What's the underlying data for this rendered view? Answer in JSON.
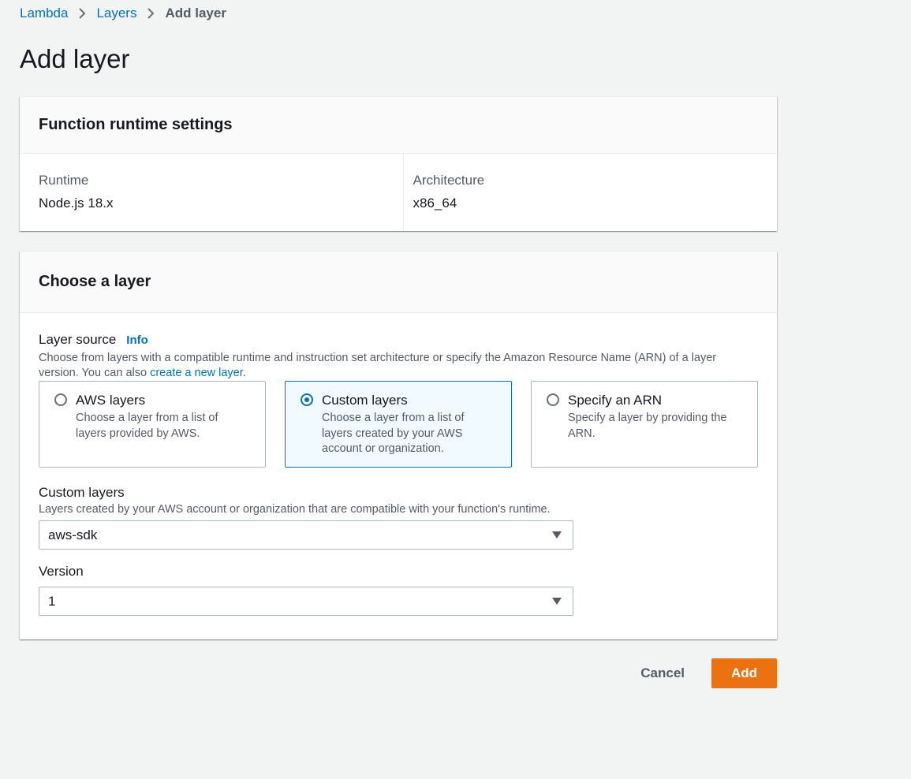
{
  "breadcrumb": {
    "items": [
      {
        "label": "Lambda"
      },
      {
        "label": "Layers"
      },
      {
        "label": "Add layer"
      }
    ]
  },
  "page": {
    "title": "Add layer"
  },
  "runtime_settings": {
    "title": "Function runtime settings",
    "runtime_label": "Runtime",
    "runtime_value": "Node.js 18.x",
    "architecture_label": "Architecture",
    "architecture_value": "x86_64"
  },
  "choose_layer": {
    "title": "Choose a layer",
    "source_label": "Layer source",
    "info_link": "Info",
    "source_desc_pre": "Choose from layers with a compatible runtime and instruction set architecture or specify the Amazon Resource Name (ARN) of a layer version. You can also ",
    "source_desc_link": "create a new layer",
    "source_desc_post": ".",
    "options": [
      {
        "title": "AWS layers",
        "desc": "Choose a layer from a list of layers provided by AWS.",
        "selected": false
      },
      {
        "title": "Custom layers",
        "desc": "Choose a layer from a list of layers created by your AWS account or organization.",
        "selected": true
      },
      {
        "title": "Specify an ARN",
        "desc": "Specify a layer by providing the ARN.",
        "selected": false
      }
    ],
    "custom_layers_label": "Custom layers",
    "custom_layers_desc": "Layers created by your AWS account or organization that are compatible with your function's runtime.",
    "custom_layers_value": "aws-sdk",
    "version_label": "Version",
    "version_value": "1"
  },
  "actions": {
    "cancel_label": "Cancel",
    "add_label": "Add"
  },
  "colors": {
    "accent": "#0073bb",
    "primary_button": "#ec7211",
    "background": "#f2f3f3"
  }
}
